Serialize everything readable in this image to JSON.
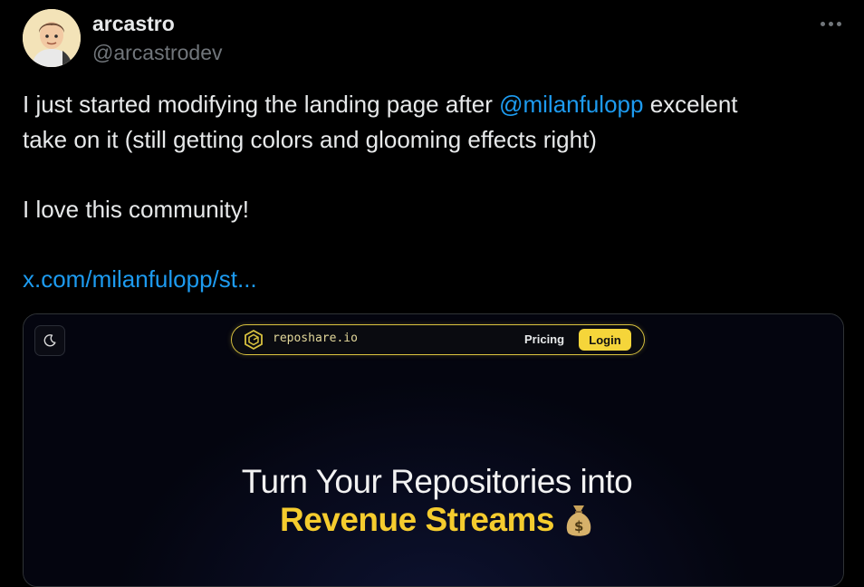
{
  "author": {
    "display_name": "arcastro",
    "handle": "@arcastrodev",
    "avatar": "memoji-avatar"
  },
  "more_icon": "ellipsis-icon",
  "tweet": {
    "line1_before": "I just started modifying the landing page after ",
    "mention": "@milanfulopp",
    "line1_after": " excelent",
    "line2": "take on it (still getting colors and glooming effects right)",
    "line3": "I love this community!",
    "link": "x.com/milanfulopp/st..."
  },
  "card": {
    "theme_toggle_icon": "moon-icon",
    "brand_name": "reposhare.io",
    "nav_pricing": "Pricing",
    "nav_login": "Login",
    "hero_line1": "Turn Your Repositories into",
    "hero_line2": "Revenue Streams",
    "hero_emoji_icon": "money-bag-icon"
  },
  "colors": {
    "background": "#000000",
    "text": "#e7e9ea",
    "secondary_text": "#71767b",
    "link": "#1d9bf0",
    "accent_yellow": "#f5cc2e"
  }
}
